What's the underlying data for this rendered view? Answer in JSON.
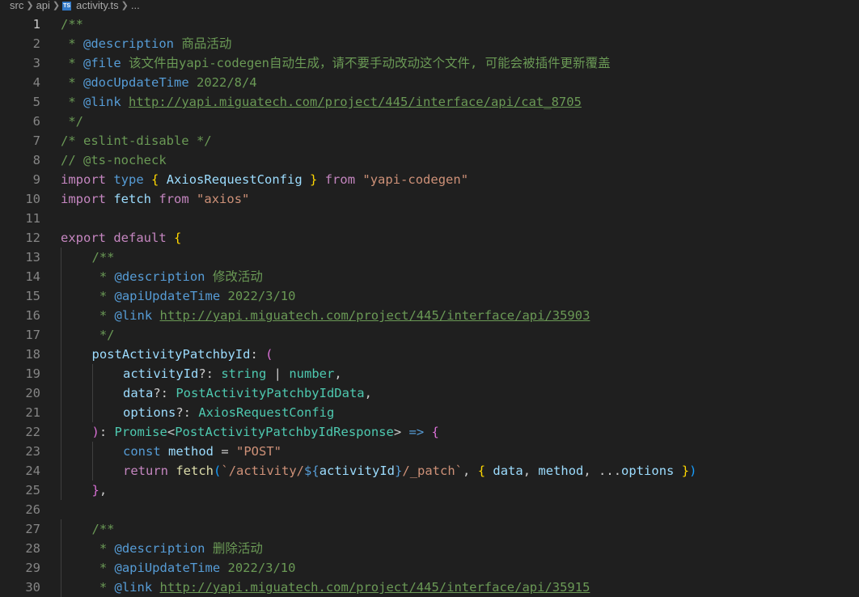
{
  "breadcrumb": {
    "parts": [
      "src",
      "api",
      "activity.ts",
      "..."
    ],
    "file_icon_label": "TS"
  },
  "editor": {
    "active_line": 1,
    "lines": [
      {
        "n": 1,
        "indent": 0,
        "tokens": [
          [
            "c",
            "/**"
          ]
        ]
      },
      {
        "n": 2,
        "indent": 0,
        "tokens": [
          [
            "c",
            " * "
          ],
          [
            "tag",
            "@description"
          ],
          [
            "c",
            " 商品活动"
          ]
        ]
      },
      {
        "n": 3,
        "indent": 0,
        "tokens": [
          [
            "c",
            " * "
          ],
          [
            "tag",
            "@file"
          ],
          [
            "c",
            " 该文件由yapi-codegen自动生成，请不要手动改动这个文件, 可能会被插件更新覆盖"
          ]
        ]
      },
      {
        "n": 4,
        "indent": 0,
        "tokens": [
          [
            "c",
            " * "
          ],
          [
            "tag",
            "@docUpdateTime"
          ],
          [
            "c",
            " 2022/8/4"
          ]
        ]
      },
      {
        "n": 5,
        "indent": 0,
        "tokens": [
          [
            "c",
            " * "
          ],
          [
            "tag",
            "@link"
          ],
          [
            "c",
            " "
          ],
          [
            "lnk",
            "http://yapi.miguatech.com/project/445/interface/api/cat_8705"
          ]
        ]
      },
      {
        "n": 6,
        "indent": 0,
        "tokens": [
          [
            "c",
            " */"
          ]
        ]
      },
      {
        "n": 7,
        "indent": 0,
        "tokens": [
          [
            "c",
            "/* eslint-disable */"
          ]
        ]
      },
      {
        "n": 8,
        "indent": 0,
        "tokens": [
          [
            "c",
            "// @ts-nocheck"
          ]
        ]
      },
      {
        "n": 9,
        "indent": 0,
        "tokens": [
          [
            "k",
            "import"
          ],
          [
            "p",
            " "
          ],
          [
            "kb",
            "type"
          ],
          [
            "p",
            " "
          ],
          [
            "b1",
            "{"
          ],
          [
            "p",
            " "
          ],
          [
            "v",
            "AxiosRequestConfig"
          ],
          [
            "p",
            " "
          ],
          [
            "b1",
            "}"
          ],
          [
            "p",
            " "
          ],
          [
            "k",
            "from"
          ],
          [
            "p",
            " "
          ],
          [
            "s",
            "\"yapi-codegen\""
          ]
        ]
      },
      {
        "n": 10,
        "indent": 0,
        "tokens": [
          [
            "k",
            "import"
          ],
          [
            "p",
            " "
          ],
          [
            "v",
            "fetch"
          ],
          [
            "p",
            " "
          ],
          [
            "k",
            "from"
          ],
          [
            "p",
            " "
          ],
          [
            "s",
            "\"axios\""
          ]
        ]
      },
      {
        "n": 11,
        "indent": 0,
        "tokens": []
      },
      {
        "n": 12,
        "indent": 0,
        "tokens": [
          [
            "k",
            "export"
          ],
          [
            "p",
            " "
          ],
          [
            "k",
            "default"
          ],
          [
            "p",
            " "
          ],
          [
            "b1",
            "{"
          ]
        ]
      },
      {
        "n": 13,
        "indent": 1,
        "tokens": [
          [
            "c",
            "/**"
          ]
        ]
      },
      {
        "n": 14,
        "indent": 1,
        "tokens": [
          [
            "c",
            " * "
          ],
          [
            "tag",
            "@description"
          ],
          [
            "c",
            " 修改活动"
          ]
        ]
      },
      {
        "n": 15,
        "indent": 1,
        "tokens": [
          [
            "c",
            " * "
          ],
          [
            "tag",
            "@apiUpdateTime"
          ],
          [
            "c",
            " 2022/3/10"
          ]
        ]
      },
      {
        "n": 16,
        "indent": 1,
        "tokens": [
          [
            "c",
            " * "
          ],
          [
            "tag",
            "@link"
          ],
          [
            "c",
            " "
          ],
          [
            "lnk",
            "http://yapi.miguatech.com/project/445/interface/api/35903"
          ]
        ]
      },
      {
        "n": 17,
        "indent": 1,
        "tokens": [
          [
            "c",
            " */"
          ]
        ]
      },
      {
        "n": 18,
        "indent": 1,
        "tokens": [
          [
            "v",
            "postActivityPatchbyId"
          ],
          [
            "p",
            ": "
          ],
          [
            "b2",
            "("
          ]
        ]
      },
      {
        "n": 19,
        "indent": 2,
        "tokens": [
          [
            "v",
            "activityId"
          ],
          [
            "p",
            "?: "
          ],
          [
            "t",
            "string"
          ],
          [
            "p",
            " | "
          ],
          [
            "t",
            "number"
          ],
          [
            "p",
            ","
          ]
        ]
      },
      {
        "n": 20,
        "indent": 2,
        "tokens": [
          [
            "v",
            "data"
          ],
          [
            "p",
            "?: "
          ],
          [
            "t",
            "PostActivityPatchbyIdData"
          ],
          [
            "p",
            ","
          ]
        ]
      },
      {
        "n": 21,
        "indent": 2,
        "tokens": [
          [
            "v",
            "options"
          ],
          [
            "p",
            "?: "
          ],
          [
            "t",
            "AxiosRequestConfig"
          ]
        ]
      },
      {
        "n": 22,
        "indent": 1,
        "tokens": [
          [
            "b2",
            ")"
          ],
          [
            "p",
            ": "
          ],
          [
            "t",
            "Promise"
          ],
          [
            "p",
            "<"
          ],
          [
            "t",
            "PostActivityPatchbyIdResponse"
          ],
          [
            "p",
            "> "
          ],
          [
            "kb",
            "=>"
          ],
          [
            "p",
            " "
          ],
          [
            "b2",
            "{"
          ]
        ]
      },
      {
        "n": 23,
        "indent": 2,
        "tokens": [
          [
            "kb",
            "const"
          ],
          [
            "p",
            " "
          ],
          [
            "v",
            "method"
          ],
          [
            "p",
            " = "
          ],
          [
            "s",
            "\"POST\""
          ]
        ]
      },
      {
        "n": 24,
        "indent": 2,
        "tokens": [
          [
            "k",
            "return"
          ],
          [
            "p",
            " "
          ],
          [
            "f",
            "fetch"
          ],
          [
            "b3",
            "("
          ],
          [
            "s",
            "`/activity/"
          ],
          [
            "kb",
            "${"
          ],
          [
            "v",
            "activityId"
          ],
          [
            "kb",
            "}"
          ],
          [
            "s",
            "/_patch`"
          ],
          [
            "p",
            ", "
          ],
          [
            "b1",
            "{"
          ],
          [
            "p",
            " "
          ],
          [
            "v",
            "data"
          ],
          [
            "p",
            ", "
          ],
          [
            "v",
            "method"
          ],
          [
            "p",
            ", ..."
          ],
          [
            "v",
            "options"
          ],
          [
            "p",
            " "
          ],
          [
            "b1",
            "}"
          ],
          [
            "b3",
            ")"
          ]
        ]
      },
      {
        "n": 25,
        "indent": 1,
        "tokens": [
          [
            "b2",
            "}"
          ],
          [
            "p",
            ","
          ]
        ]
      },
      {
        "n": 26,
        "indent": 0,
        "tokens": []
      },
      {
        "n": 27,
        "indent": 1,
        "tokens": [
          [
            "c",
            "/**"
          ]
        ]
      },
      {
        "n": 28,
        "indent": 1,
        "tokens": [
          [
            "c",
            " * "
          ],
          [
            "tag",
            "@description"
          ],
          [
            "c",
            " 删除活动"
          ]
        ]
      },
      {
        "n": 29,
        "indent": 1,
        "tokens": [
          [
            "c",
            " * "
          ],
          [
            "tag",
            "@apiUpdateTime"
          ],
          [
            "c",
            " 2022/3/10"
          ]
        ]
      },
      {
        "n": 30,
        "indent": 1,
        "tokens": [
          [
            "c",
            " * "
          ],
          [
            "tag",
            "@link"
          ],
          [
            "c",
            " "
          ],
          [
            "lnk",
            "http://yapi.miguatech.com/project/445/interface/api/35915"
          ]
        ]
      }
    ]
  }
}
